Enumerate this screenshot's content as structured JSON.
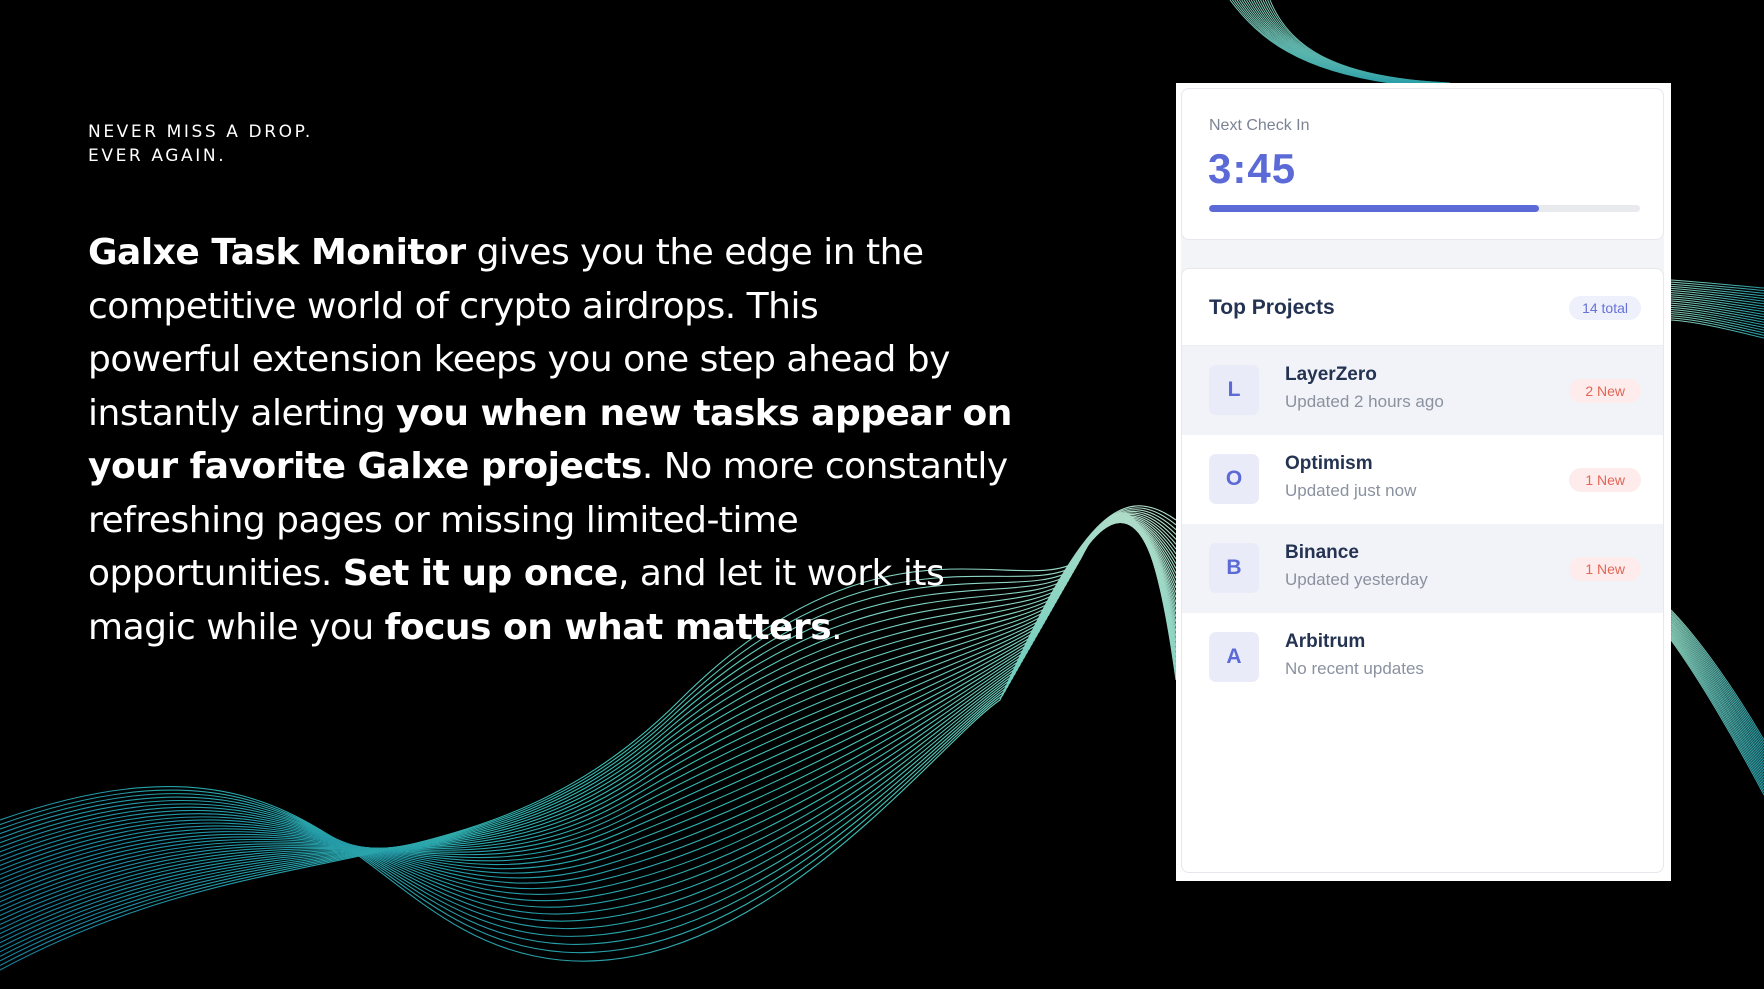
{
  "tagline": {
    "line1": "NEVER MISS A DROP.",
    "line2": "EVER AGAIN."
  },
  "headline": {
    "l1_bold": "Galxe Task Monitor",
    "l1_rest": " gives you the edge in the",
    "l2": "competitive world of crypto airdrops. This",
    "l3": "powerful extension keeps you one step ahead by",
    "l4_plain": "instantly alerting ",
    "l4_bold": "you when new tasks appear on",
    "l5_bold": "your favorite Galxe projects",
    "l5_rest": ". No more constantly",
    "l6": "refreshing pages or missing limited-time",
    "l7_plain": "opportunities. ",
    "l7_bold": "Set it up once",
    "l7_rest": ", and let it work its",
    "l8_plain": "magic while you ",
    "l8_bold": "focus on what matters",
    "l8_rest": "."
  },
  "extension": {
    "next_check_label": "Next Check In",
    "next_check_time": "3:45",
    "progress_fraction": 0.765,
    "projects_title": "Top Projects",
    "projects_total": "14 total",
    "projects": [
      {
        "initial": "L",
        "name": "LayerZero",
        "status": "Updated 2 hours ago",
        "badge": "2 New",
        "highlight": true
      },
      {
        "initial": "O",
        "name": "Optimism",
        "status": "Updated just now",
        "badge": "1 New",
        "highlight": false
      },
      {
        "initial": "B",
        "name": "Binance",
        "status": "Updated yesterday",
        "badge": "1 New",
        "highlight": true
      },
      {
        "initial": "A",
        "name": "Arbitrum",
        "status": "No recent updates",
        "badge": "",
        "highlight": false
      }
    ]
  },
  "colors": {
    "accent": "#5b6ad6",
    "wave_teal": "#3fd6c8",
    "wave_mint": "#b9f3d9",
    "badge_red": "#e26656"
  }
}
